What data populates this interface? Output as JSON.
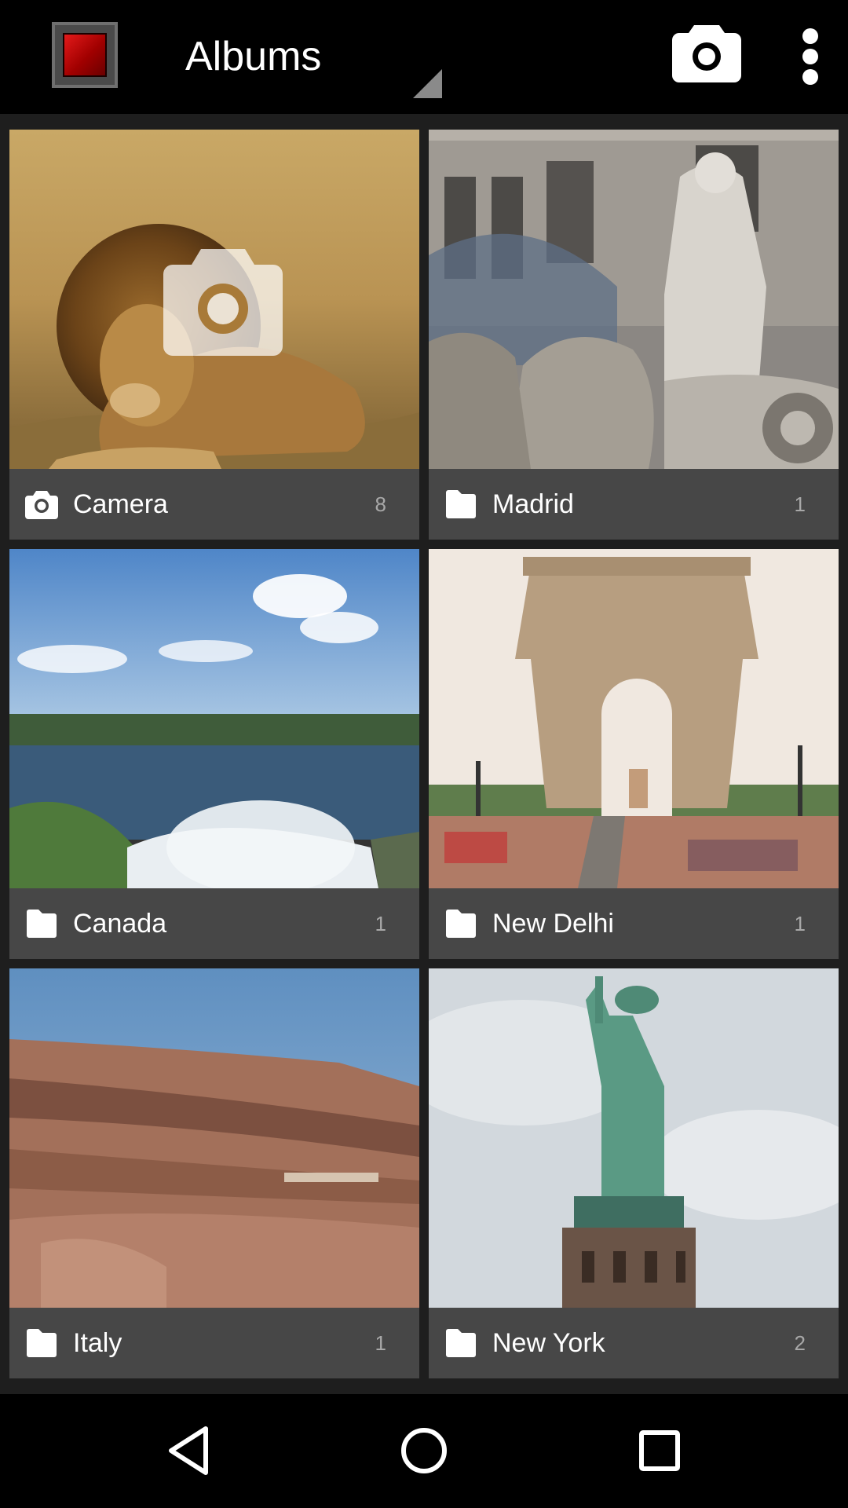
{
  "app": {
    "icon": "app-icon-red-square",
    "title": "Albums",
    "actions": {
      "camera_icon": "camera-icon",
      "overflow_icon": "more-vert-icon"
    }
  },
  "albums": [
    {
      "name": "Camera",
      "count": "8",
      "icon": "camera-icon",
      "thumbnail": "lion in dry grass"
    },
    {
      "name": "Madrid",
      "count": "1",
      "icon": "folder-icon",
      "thumbnail": "Cibeles fountain statue"
    },
    {
      "name": "Canada",
      "count": "1",
      "icon": "folder-icon",
      "thumbnail": "Niagara Falls"
    },
    {
      "name": "New Delhi",
      "count": "1",
      "icon": "folder-icon",
      "thumbnail": "India Gate"
    },
    {
      "name": "Italy",
      "count": "1",
      "icon": "folder-icon",
      "thumbnail": "Colosseum interior"
    },
    {
      "name": "New York",
      "count": "2",
      "icon": "folder-icon",
      "thumbnail": "Statue of Liberty"
    }
  ],
  "navbar": {
    "back_icon": "back-icon",
    "home_icon": "home-icon",
    "recents_icon": "recents-icon"
  },
  "colors": {
    "actionbar": "#000000",
    "background": "#1e1e1e",
    "label_bar": "#474747",
    "app_icon_red": "#cc0000"
  }
}
